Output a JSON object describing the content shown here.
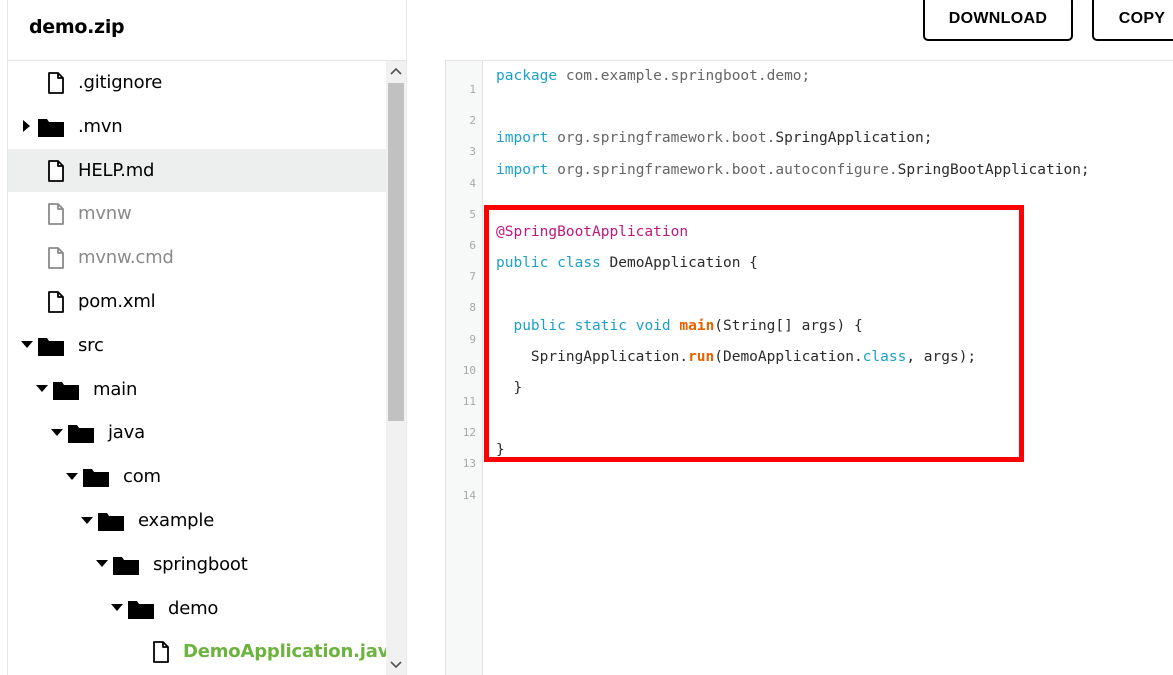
{
  "sidebar": {
    "title": "demo.zip",
    "items": [
      {
        "label": ".gitignore",
        "type": "file",
        "depth": 0,
        "state": "normal"
      },
      {
        "label": ".mvn",
        "type": "folder",
        "depth": 0,
        "state": "collapsed"
      },
      {
        "label": "HELP.md",
        "type": "file",
        "depth": 0,
        "state": "selected"
      },
      {
        "label": "mvnw",
        "type": "file",
        "depth": 0,
        "state": "dim"
      },
      {
        "label": "mvnw.cmd",
        "type": "file",
        "depth": 0,
        "state": "dim"
      },
      {
        "label": "pom.xml",
        "type": "file",
        "depth": 0,
        "state": "normal"
      },
      {
        "label": "src",
        "type": "folder",
        "depth": 0,
        "state": "expanded"
      },
      {
        "label": "main",
        "type": "folder",
        "depth": 1,
        "state": "expanded"
      },
      {
        "label": "java",
        "type": "folder",
        "depth": 2,
        "state": "expanded"
      },
      {
        "label": "com",
        "type": "folder",
        "depth": 3,
        "state": "expanded"
      },
      {
        "label": "example",
        "type": "folder",
        "depth": 4,
        "state": "expanded"
      },
      {
        "label": "springboot",
        "type": "folder",
        "depth": 5,
        "state": "expanded"
      },
      {
        "label": "demo",
        "type": "folder",
        "depth": 6,
        "state": "expanded"
      },
      {
        "label": "DemoApplication.java",
        "type": "file",
        "depth": 7,
        "state": "active"
      }
    ]
  },
  "toolbar": {
    "download_label": "DOWNLOAD",
    "copy_label": "COPY"
  },
  "editor": {
    "line_numbers": [
      "1",
      "2",
      "3",
      "4",
      "5",
      "6",
      "7",
      "8",
      "9",
      "10",
      "11",
      "12",
      "13",
      "14"
    ],
    "lines": [
      [
        {
          "t": "package",
          "c": "kw"
        },
        {
          "t": " com.example.springboot.demo;",
          "c": "pkg"
        }
      ],
      [],
      [
        {
          "t": "import",
          "c": "kw"
        },
        {
          "t": " org.springframework.boot.",
          "c": "pkg"
        },
        {
          "t": "SpringApplication;",
          "c": ""
        }
      ],
      [
        {
          "t": "import",
          "c": "kw"
        },
        {
          "t": " org.springframework.boot.autoconfigure.",
          "c": "pkg"
        },
        {
          "t": "SpringBootApplication;",
          "c": ""
        }
      ],
      [],
      [
        {
          "t": "@SpringBootApplication",
          "c": "ann"
        }
      ],
      [
        {
          "t": "public",
          "c": "kw"
        },
        {
          "t": " ",
          "c": ""
        },
        {
          "t": "class",
          "c": "kw"
        },
        {
          "t": " DemoApplication {",
          "c": ""
        }
      ],
      [],
      [
        {
          "t": "  ",
          "c": ""
        },
        {
          "t": "public",
          "c": "kw"
        },
        {
          "t": " ",
          "c": ""
        },
        {
          "t": "static",
          "c": "kw"
        },
        {
          "t": " ",
          "c": ""
        },
        {
          "t": "void",
          "c": "kw"
        },
        {
          "t": " ",
          "c": ""
        },
        {
          "t": "main",
          "c": "fn"
        },
        {
          "t": "(String[] args) {",
          "c": ""
        }
      ],
      [
        {
          "t": "    SpringApplication.",
          "c": ""
        },
        {
          "t": "run",
          "c": "fn"
        },
        {
          "t": "(DemoApplication.",
          "c": ""
        },
        {
          "t": "class",
          "c": "kw"
        },
        {
          "t": ", args);",
          "c": ""
        }
      ],
      [
        {
          "t": "  }",
          "c": ""
        }
      ],
      [],
      [
        {
          "t": "}",
          "c": ""
        }
      ],
      []
    ]
  },
  "colors": {
    "accent_green": "#6db33f",
    "highlight_red": "#ff0000",
    "keyword_blue": "#1ba1c9",
    "annotation_magenta": "#c0177d",
    "method_orange": "#e66100"
  },
  "icons": {
    "file": "file-icon",
    "folder": "folder-icon",
    "caret_right": "caret-right-icon",
    "caret_down": "caret-down-icon",
    "scroll_up": "chevron-up-icon",
    "scroll_down": "chevron-down-icon"
  }
}
